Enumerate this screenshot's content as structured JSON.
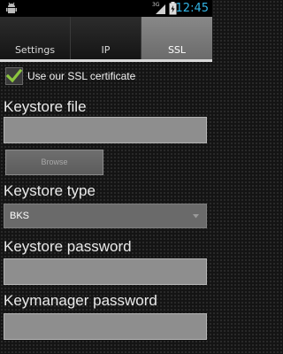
{
  "status_bar": {
    "network_type": "3G",
    "battery_icon": "battery-charging-icon",
    "signal_icon": "cell-signal-icon",
    "notification_icon": "android-debug-icon",
    "time": "12:45",
    "time_color": "#33b5e5"
  },
  "tabs": [
    {
      "label": "Settings",
      "active": false
    },
    {
      "label": "IP",
      "active": false
    },
    {
      "label": "SSL",
      "active": true
    }
  ],
  "ssl_checkbox": {
    "label": "Use our SSL certificate",
    "checked": true,
    "check_color": "#8cc63f"
  },
  "keystore_file": {
    "label": "Keystore file",
    "value": "",
    "browse_label": "Browse"
  },
  "keystore_type": {
    "label": "Keystore type",
    "selected": "BKS"
  },
  "keystore_password": {
    "label": "Keystore password",
    "value": ""
  },
  "keymanager_password": {
    "label": "Keymanager password",
    "value": ""
  }
}
